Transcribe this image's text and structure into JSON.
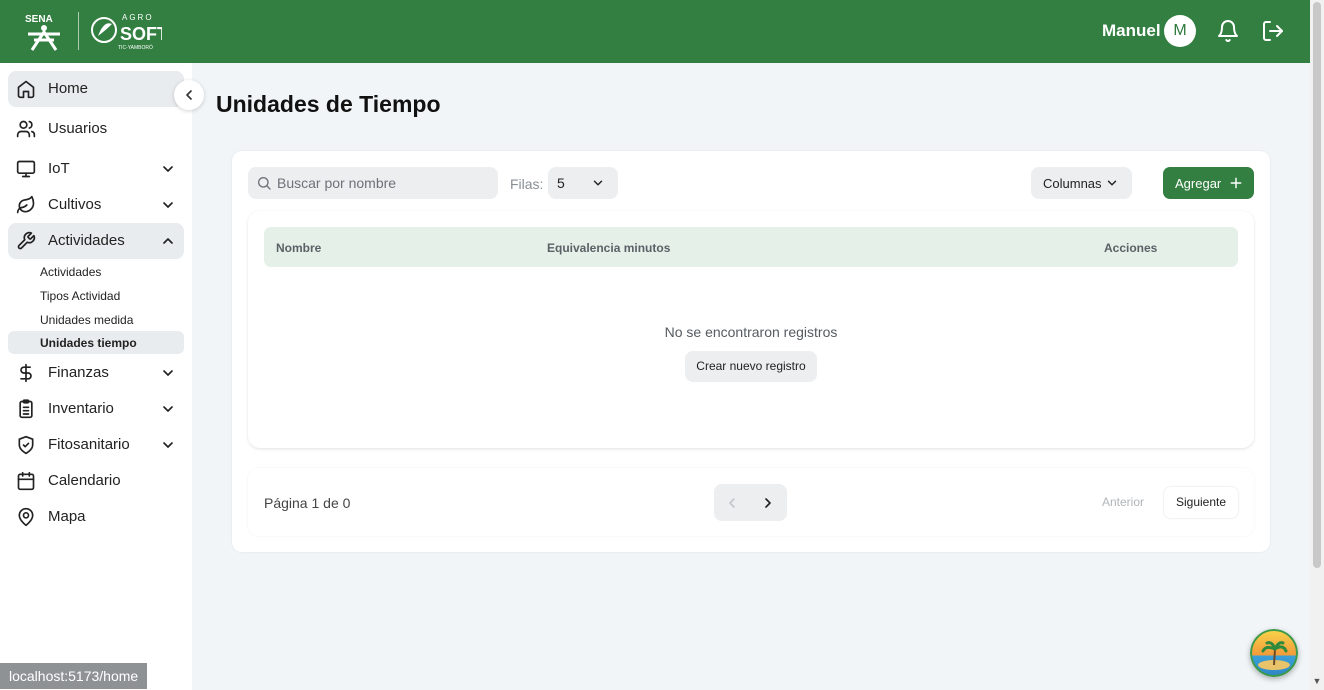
{
  "header": {
    "user_name": "Manuel",
    "avatar_initial": "M",
    "brand_color": "#327f41"
  },
  "sidebar": {
    "items": [
      {
        "label": "Home",
        "icon": "home-icon"
      },
      {
        "label": "Usuarios",
        "icon": "users-icon"
      },
      {
        "label": "IoT",
        "icon": "monitor-icon"
      },
      {
        "label": "Cultivos",
        "icon": "leaf-icon"
      },
      {
        "label": "Actividades",
        "icon": "wrench-icon"
      },
      {
        "label": "Finanzas",
        "icon": "dollar-icon"
      },
      {
        "label": "Inventario",
        "icon": "clipboard-list-icon"
      },
      {
        "label": "Fitosanitario",
        "icon": "shield-check-icon"
      },
      {
        "label": "Calendario",
        "icon": "calendar-icon"
      },
      {
        "label": "Mapa",
        "icon": "map-pin-icon"
      }
    ],
    "sub_items": [
      {
        "label": "Actividades"
      },
      {
        "label": "Tipos Actividad"
      },
      {
        "label": "Unidades medida"
      },
      {
        "label": "Unidades tiempo"
      }
    ]
  },
  "page": {
    "title": "Unidades de Tiempo"
  },
  "toolbar": {
    "search_placeholder": "Buscar por nombre",
    "rows_label": "Filas:",
    "rows_value": "5",
    "columns_label": "Columnas",
    "add_label": "Agregar"
  },
  "table": {
    "headers": [
      "Nombre",
      "Equivalencia minutos",
      "Acciones"
    ],
    "empty_text": "No se encontraron registros",
    "create_label": "Crear nuevo registro"
  },
  "pagination": {
    "info": "Página 1 de 0",
    "prev_label": "Anterior",
    "next_label": "Siguiente"
  },
  "status_url": "localhost:5173/home"
}
